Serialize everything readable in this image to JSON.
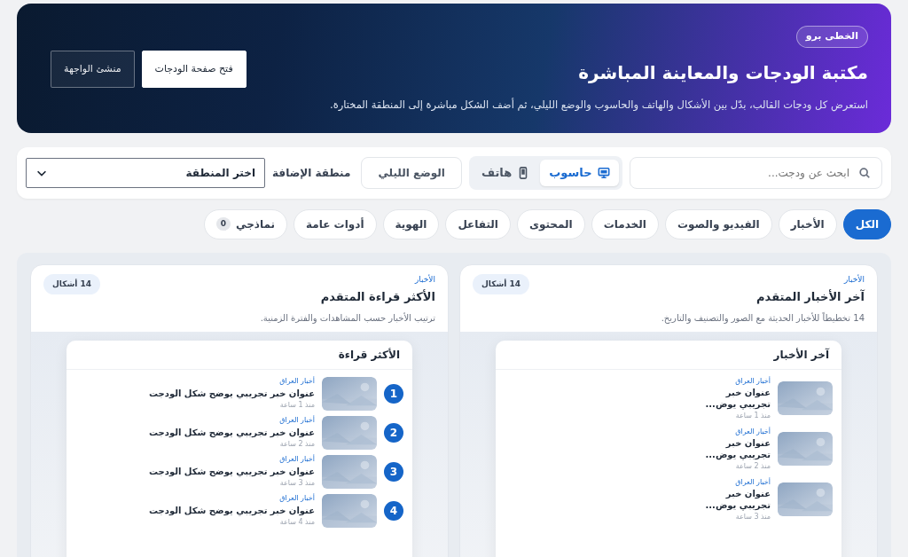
{
  "hero": {
    "badge": "الخطى برو",
    "title": "مكتبة الودجات والمعاينة المباشرة",
    "subtitle": "استعرض كل ودجات القالب، بدّل بين الأشكال والهاتف والحاسوب والوضع الليلي، ثم أضف الشكل مباشرة إلى المنطقة المختارة.",
    "buttons": [
      {
        "label": "فتح صفحة الودجات",
        "kind": "light"
      },
      {
        "label": "منشئ الواجهة",
        "kind": "outline"
      }
    ]
  },
  "toolbar": {
    "search": {
      "placeholder": "ابحث عن ودجت..."
    },
    "devices": [
      {
        "label": "حاسوب",
        "kind": "desktop",
        "selected": true
      },
      {
        "label": "هاتف",
        "kind": "phone",
        "selected": false
      }
    ],
    "dark_mode": {
      "label": "الوضع الليلي",
      "on": false
    },
    "zone_label": "منطقة الإضافة",
    "zone_select": "اختر المنطقة"
  },
  "filters": [
    {
      "label": "الكل",
      "selected": true
    },
    {
      "label": "الأخبار",
      "selected": false
    },
    {
      "label": "الفيديو والصوت",
      "selected": false
    },
    {
      "label": "الخدمات",
      "selected": false
    },
    {
      "label": "المحتوى",
      "selected": false
    },
    {
      "label": "التفاعل",
      "selected": false
    },
    {
      "label": "الهوية",
      "selected": false
    },
    {
      "label": "أدوات عامة",
      "selected": false
    },
    {
      "label": "نماذجي",
      "selected": false,
      "count": "0"
    }
  ],
  "cards": [
    {
      "category": "الأخبار",
      "title": "آخر الأخبار المتقدم",
      "description": "14 تخطيطاً للأخبار الحديثة مع الصور والتصنيف والتاريخ.",
      "count": "14 أشكال",
      "widget": {
        "title": "آخر الأخبار",
        "kind": "list",
        "items": [
          {
            "category": "أخبار العراق",
            "title": "عنوان خبر تجريبي يوض...",
            "time": "منذ 1 ساعة"
          },
          {
            "category": "أخبار العراق",
            "title": "عنوان خبر تجريبي يوض...",
            "time": "منذ 2 ساعة"
          },
          {
            "category": "أخبار العراق",
            "title": "عنوان خبر تجريبي يوض...",
            "time": "منذ 3 ساعة"
          }
        ]
      }
    },
    {
      "category": "الأخبار",
      "title": "الأكثر قراءة المتقدم",
      "description": "ترتيب الأخبار حسب المشاهدات والفترة الزمنية.",
      "count": "14 أشكال",
      "widget": {
        "title": "الأكثر قراءة",
        "kind": "ranked",
        "items": [
          {
            "rank": "1",
            "category": "أخبار العراق",
            "title": "عنوان خبر تجريبي يوضح شكل الودجت",
            "time": "منذ 1 ساعة"
          },
          {
            "rank": "2",
            "category": "أخبار العراق",
            "title": "عنوان خبر تجريبي يوضح شكل الودجت",
            "time": "منذ 2 ساعة"
          },
          {
            "rank": "3",
            "category": "أخبار العراق",
            "title": "عنوان خبر تجريبي يوضح شكل الودجت",
            "time": "منذ 3 ساعة"
          },
          {
            "rank": "4",
            "category": "أخبار العراق",
            "title": "عنوان خبر تجريبي يوضح شكل الودجت",
            "time": "منذ 4 ساعة"
          }
        ]
      }
    }
  ]
}
